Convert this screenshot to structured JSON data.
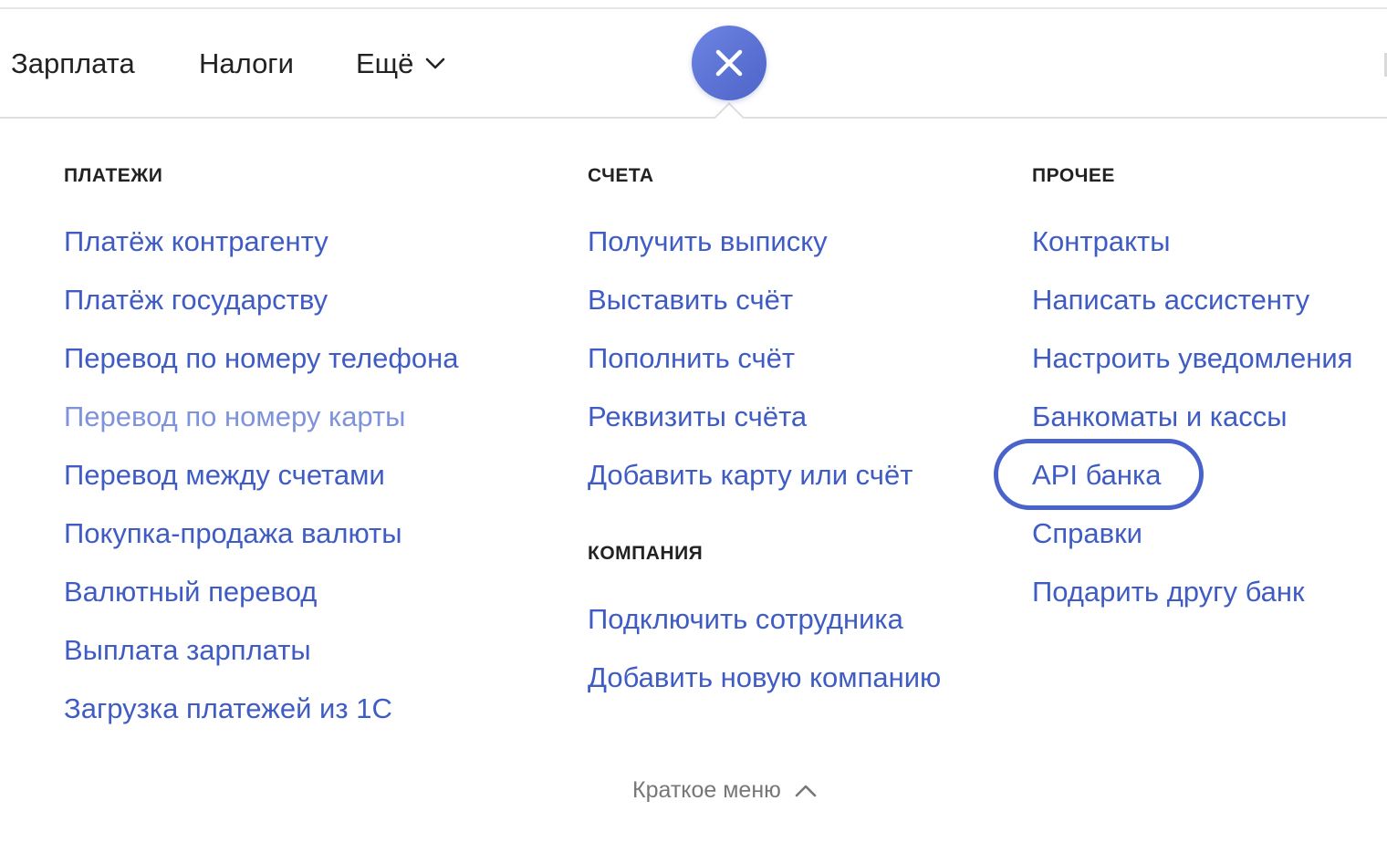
{
  "nav": {
    "salary": "Зарплата",
    "taxes": "Налоги",
    "more": "Ещё"
  },
  "icons": {
    "close": "close-icon",
    "chevron_down": "chevron-down-icon",
    "chevron_up": "chevron-up-icon"
  },
  "colors": {
    "accent": "#4e64c8",
    "link": "#3f5cc4",
    "link_muted": "#7e93db"
  },
  "menu": {
    "payments": {
      "heading": "ПЛАТЕЖИ",
      "items": [
        "Платёж контрагенту",
        "Платёж государству",
        "Перевод по номеру телефона",
        "Перевод по номеру карты",
        "Перевод между счетами",
        "Покупка-продажа валюты",
        "Валютный перевод",
        "Выплата зарплаты",
        "Загрузка платежей из 1С"
      ]
    },
    "accounts": {
      "heading": "СЧЕТА",
      "items": [
        "Получить выписку",
        "Выставить счёт",
        "Пополнить счёт",
        "Реквизиты счёта",
        "Добавить карту или счёт"
      ]
    },
    "company": {
      "heading": "КОМПАНИЯ",
      "items": [
        "Подключить сотрудника",
        "Добавить новую компанию"
      ]
    },
    "other": {
      "heading": "ПРОЧЕЕ",
      "items": [
        "Контракты",
        "Написать ассистенту",
        "Настроить уведомления",
        "Банкоматы и кассы",
        "API банка",
        "Справки",
        "Подарить другу банк"
      ]
    }
  },
  "footer": {
    "short_menu": "Краткое меню"
  }
}
